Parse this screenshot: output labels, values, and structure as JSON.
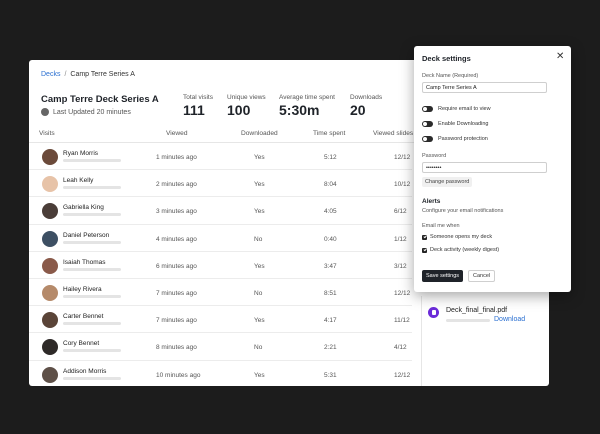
{
  "breadcrumb": {
    "root": "Decks",
    "separator": "/",
    "current": "Camp Terre Series A"
  },
  "deck": {
    "title": "Camp Terre Deck Series A",
    "updated": "Last Updated 20 minutes"
  },
  "stats": [
    {
      "label": "Total visits",
      "value": "111"
    },
    {
      "label": "Unique views",
      "value": "100"
    },
    {
      "label": "Average time spent",
      "value": "5:30m"
    },
    {
      "label": "Downloads",
      "value": "20"
    }
  ],
  "table": {
    "columns": {
      "visits": "Visits",
      "viewed": "Viewed",
      "downloaded": "Downloaded",
      "time": "Time spent",
      "slides": "Viewed slides"
    },
    "rows": [
      {
        "name": "Ryan Morris",
        "viewed": "1 minutes ago",
        "downloaded": "Yes",
        "time": "5:12",
        "slides": "12/12"
      },
      {
        "name": "Leah Kelly",
        "viewed": "2 minutes ago",
        "downloaded": "Yes",
        "time": "8:04",
        "slides": "10/12"
      },
      {
        "name": "Gabriella King",
        "viewed": "3 minutes ago",
        "downloaded": "Yes",
        "time": "4:05",
        "slides": "6/12"
      },
      {
        "name": "Daniel Peterson",
        "viewed": "4 minutes ago",
        "downloaded": "No",
        "time": "0:40",
        "slides": "1/12"
      },
      {
        "name": "Isaiah Thomas",
        "viewed": "6 minutes ago",
        "downloaded": "Yes",
        "time": "3:47",
        "slides": "3/12"
      },
      {
        "name": "Hailey Rivera",
        "viewed": "7 minutes ago",
        "downloaded": "No",
        "time": "8:51",
        "slides": "12/12"
      },
      {
        "name": "Carter Bennet",
        "viewed": "7 minutes ago",
        "downloaded": "Yes",
        "time": "4:17",
        "slides": "11/12"
      },
      {
        "name": "Cory Bennet",
        "viewed": "8 minutes ago",
        "downloaded": "No",
        "time": "2:21",
        "slides": "4/12"
      },
      {
        "name": "Addison Morris",
        "viewed": "10 minutes ago",
        "downloaded": "Yes",
        "time": "5:31",
        "slides": "12/12"
      }
    ]
  },
  "file": {
    "name": "Deck_final_final.pdf",
    "download_label": "Download"
  },
  "settings": {
    "title": "Deck settings",
    "name_label": "Deck Name (Required)",
    "name_value": "Camp Terre Series A",
    "toggles": [
      "Require email to view",
      "Enable Downloading",
      "Password protection"
    ],
    "password_label": "Password",
    "password_value": "••••••••",
    "change_password": "Change password",
    "alerts_title": "Alerts",
    "alerts_sub": "Configure your email notifications",
    "email_when": "Email me when",
    "checks": [
      "Someone opens my deck",
      "Deck activity (weekly digest)"
    ],
    "save": "Save settings",
    "cancel": "Cancel"
  },
  "colors": {
    "accent_link": "#2a6fd1",
    "pdf_icon": "#6b2bd9",
    "primary_button": "#1f2329"
  }
}
